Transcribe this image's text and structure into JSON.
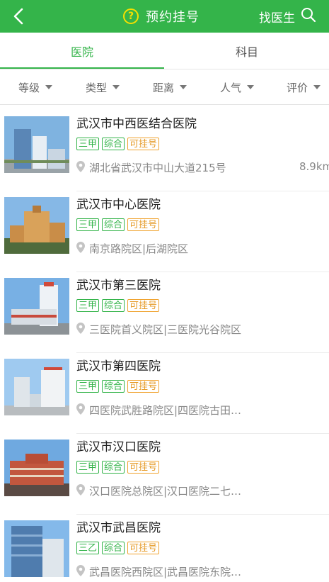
{
  "header": {
    "title": "预约挂号",
    "help_icon": "?",
    "find_doctor_label": "找医生",
    "bg_color": "#34b44a"
  },
  "tabs": [
    {
      "label": "医院",
      "active": true
    },
    {
      "label": "科目",
      "active": false
    }
  ],
  "filters": [
    "等级",
    "类型",
    "距离",
    "人气",
    "评价"
  ],
  "hospitals": [
    {
      "name": "武汉市中西医结合医院",
      "tags": [
        "三甲",
        "综合",
        "可挂号"
      ],
      "address": "湖北省武汉市中山大道215号",
      "distance": "8.9km"
    },
    {
      "name": "武汉市中心医院",
      "tags": [
        "三甲",
        "综合",
        "可挂号"
      ],
      "address": "南京路院区|后湖院区",
      "distance": ""
    },
    {
      "name": "武汉市第三医院",
      "tags": [
        "三甲",
        "综合",
        "可挂号"
      ],
      "address": "三医院首义院区|三医院光谷院区",
      "distance": ""
    },
    {
      "name": "武汉市第四医院",
      "tags": [
        "三甲",
        "综合",
        "可挂号"
      ],
      "address": "四医院武胜路院区|四医院古田…",
      "distance": ""
    },
    {
      "name": "武汉市汉口医院",
      "tags": [
        "三甲",
        "综合",
        "可挂号"
      ],
      "address": "汉口医院总院区|汉口医院二七…",
      "distance": ""
    },
    {
      "name": "武汉市武昌医院",
      "tags": [
        "三乙",
        "综合",
        "可挂号"
      ],
      "address": "武昌医院西院区|武昌医院东院…",
      "distance": ""
    }
  ]
}
